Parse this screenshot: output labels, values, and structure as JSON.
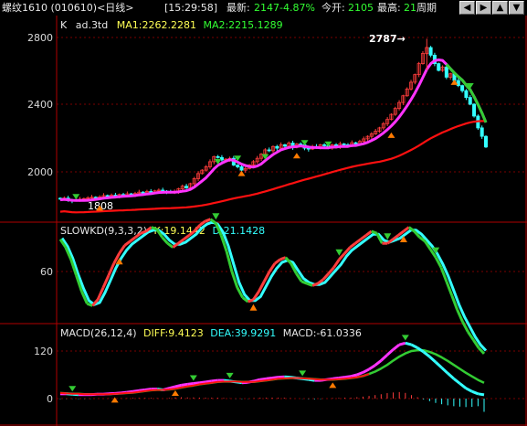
{
  "header": {
    "title": "螺纹1610 (010610)<日线>",
    "time": "[15:29:58]",
    "latest_label": "最新:",
    "latest_value": "2147",
    "change": "-4.87%",
    "open_label": "今开:",
    "open_value": "2105",
    "high_label": "最高:",
    "high_value": "21",
    "period_label": "周期",
    "nav_icons": [
      "arrow-left-icon",
      "arrow-right-icon",
      "arrow-up-icon",
      "arrow-down-icon"
    ]
  },
  "price_panel": {
    "k_label": "K",
    "formula": "ad.3td",
    "ma1": "MA1:2262.2281",
    "ma2": "MA2:2215.1289",
    "y_ticks": [
      "2800",
      "2400",
      "2000"
    ],
    "peak_label": "2787→",
    "low_label": "1808"
  },
  "kd_panel": {
    "name": "SLOWKD(9,3,3,2)",
    "k": "K:19.1442",
    "d": "D:21.1428",
    "y_ticks": [
      "60"
    ]
  },
  "macd_panel": {
    "name": "MACD(26,12,4)",
    "diff": "DIFF:9.4123",
    "dea": "DEA:39.9291",
    "macd": "MACD:-61.0336",
    "y_ticks": [
      "120",
      "0"
    ]
  },
  "colors": {
    "up": "#ff3c3c",
    "down": "#33ffff",
    "ma1": "#ff33ff",
    "ma2": "#ff1010",
    "signal_up": "#ff7a00",
    "signal_down": "#33cc33",
    "grid": "#8a0000"
  },
  "chart_data": [
    {
      "type": "candlestick",
      "title": "ad.3td",
      "ylim": [
        1750,
        2850
      ],
      "y_ticks": [
        2000,
        2400,
        2800
      ],
      "annotations": [
        {
          "text": "2787",
          "value": 2787
        },
        {
          "text": "1808",
          "value": 1808
        }
      ],
      "close_series": [
        1840,
        1845,
        1835,
        1830,
        1832,
        1838,
        1842,
        1846,
        1850,
        1848,
        1852,
        1860,
        1856,
        1862,
        1858,
        1866,
        1862,
        1870,
        1866,
        1872,
        1880,
        1876,
        1884,
        1880,
        1888,
        1892,
        1886,
        1884,
        1878,
        1882,
        1900,
        1915,
        1905,
        1930,
        1960,
        1990,
        2010,
        2030,
        2060,
        2090,
        2085,
        2070,
        2075,
        2080,
        2040,
        2030,
        2010,
        2020,
        2040,
        2060,
        2080,
        2105,
        2130,
        2125,
        2150,
        2140,
        2160,
        2152,
        2170,
        2145,
        2165,
        2160,
        2140,
        2135,
        2150,
        2145,
        2160,
        2155,
        2140,
        2160,
        2150,
        2165,
        2160,
        2158,
        2172,
        2165,
        2180,
        2195,
        2210,
        2225,
        2240,
        2260,
        2285,
        2310,
        2340,
        2375,
        2410,
        2450,
        2490,
        2530,
        2575,
        2640,
        2700,
        2735,
        2690,
        2640,
        2600,
        2620,
        2560,
        2580,
        2540,
        2510,
        2480,
        2440,
        2400,
        2330,
        2260,
        2210,
        2147
      ]
    },
    {
      "type": "line",
      "title": "SLOWKD(9,3,3,2)",
      "y_ticks": [
        60
      ],
      "series": [
        {
          "name": "K",
          "values": [
            76,
            72,
            66,
            58,
            50,
            44,
            43,
            46,
            52,
            58,
            64,
            69,
            73,
            75,
            77,
            79,
            80,
            82,
            81,
            77,
            74,
            72,
            74,
            76,
            78,
            80,
            83,
            85,
            86,
            84,
            78,
            70,
            60,
            52,
            47,
            45,
            46,
            50,
            55,
            60,
            64,
            66,
            67,
            64,
            59,
            55,
            54,
            53,
            54,
            56,
            59,
            62,
            66,
            69,
            72,
            74,
            76,
            78,
            80,
            79,
            74,
            74,
            76,
            78,
            80,
            82,
            80,
            77,
            75,
            71,
            67,
            62,
            55,
            48,
            41,
            35,
            30,
            26,
            22,
            19.1442
          ]
        },
        {
          "name": "D",
          "values": [
            77,
            73,
            67,
            59,
            52,
            46,
            44,
            45,
            50,
            56,
            62,
            67,
            71,
            74,
            76,
            78,
            80,
            81,
            81,
            79,
            76,
            74,
            74,
            75,
            77,
            79,
            82,
            84,
            85,
            84,
            80,
            73,
            64,
            55,
            49,
            46,
            46,
            48,
            53,
            58,
            62,
            65,
            66,
            65,
            61,
            57,
            55,
            54,
            54,
            55,
            58,
            61,
            64,
            68,
            71,
            73,
            75,
            77,
            79,
            79,
            76,
            75,
            76,
            77,
            79,
            81,
            81,
            79,
            76,
            73,
            69,
            64,
            58,
            51,
            44,
            38,
            33,
            28,
            24,
            21.1428
          ]
        }
      ]
    },
    {
      "type": "line",
      "title": "MACD(26,12,4)",
      "y_ticks": [
        0,
        120
      ],
      "series": [
        {
          "name": "DIFF",
          "values": [
            12,
            12,
            11,
            10,
            10,
            10,
            11,
            11,
            12,
            13,
            14,
            16,
            18,
            20,
            22,
            24,
            24,
            22,
            26,
            30,
            34,
            36,
            38,
            40,
            42,
            44,
            46,
            46,
            44,
            42,
            40,
            41,
            44,
            48,
            50,
            52,
            54,
            55,
            54,
            52,
            50,
            48,
            46,
            46,
            48,
            50,
            52,
            54,
            56,
            60,
            66,
            74,
            84,
            96,
            110,
            124,
            136,
            140,
            136,
            128,
            118,
            106,
            92,
            78,
            64,
            50,
            38,
            26,
            18,
            12,
            9.4123
          ]
        },
        {
          "name": "DEA",
          "values": [
            14,
            13,
            12,
            12,
            11,
            11,
            11,
            11,
            11,
            12,
            13,
            14,
            15,
            17,
            19,
            21,
            22,
            22,
            23,
            25,
            28,
            31,
            33,
            36,
            38,
            40,
            42,
            43,
            43,
            43,
            42,
            42,
            42,
            44,
            46,
            48,
            50,
            51,
            52,
            52,
            51,
            50,
            49,
            48,
            48,
            48,
            49,
            50,
            52,
            54,
            57,
            62,
            68,
            76,
            85,
            96,
            106,
            114,
            120,
            122,
            122,
            118,
            112,
            104,
            95,
            85,
            75,
            65,
            56,
            47,
            39.9291
          ]
        },
        {
          "name": "MACD",
          "values": [
            -2,
            -1,
            -1,
            -2,
            -1,
            -1,
            0,
            0,
            1,
            1,
            1,
            2,
            3,
            3,
            3,
            3,
            2,
            0,
            3,
            5,
            6,
            5,
            5,
            4,
            4,
            4,
            4,
            3,
            1,
            -1,
            -2,
            -1,
            2,
            4,
            4,
            4,
            4,
            4,
            2,
            0,
            -1,
            -2,
            -3,
            -2,
            0,
            2,
            3,
            4,
            4,
            6,
            9,
            12,
            16,
            20,
            25,
            28,
            30,
            26,
            16,
            6,
            -4,
            -12,
            -20,
            -26,
            -31,
            -35,
            -37,
            -39,
            -38,
            -35,
            -61.0336
          ]
        }
      ]
    }
  ]
}
